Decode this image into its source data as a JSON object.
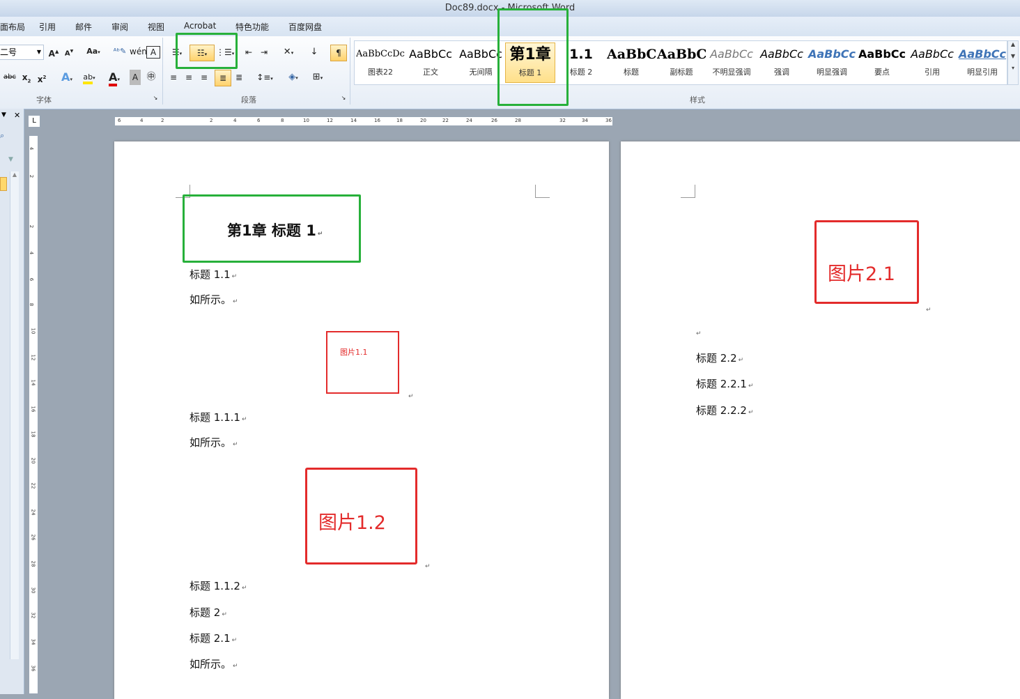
{
  "window": {
    "title": "Doc89.docx - Microsoft Word"
  },
  "tabs": [
    "页面布局",
    "引用",
    "邮件",
    "审阅",
    "视图",
    "Acrobat",
    "特色功能",
    "百度网盘"
  ],
  "font_group": {
    "font_size": "二号",
    "label": "字体"
  },
  "paragraph_group": {
    "label": "段落"
  },
  "styles_group": {
    "label": "样式",
    "items": [
      {
        "preview": "AaBbCcDc",
        "name": "图表22"
      },
      {
        "preview": "AaBbCc",
        "name": "正文"
      },
      {
        "preview": "AaBbCc",
        "name": "无间隔"
      },
      {
        "preview": "第1章",
        "name": "标题 1"
      },
      {
        "preview": "1.1",
        "name": "标题 2"
      },
      {
        "preview": "AaBbC",
        "name": "标题"
      },
      {
        "preview": "AaBbC",
        "name": "副标题"
      },
      {
        "preview": "AaBbCc",
        "name": "不明显强调"
      },
      {
        "preview": "AaBbCc",
        "name": "强调"
      },
      {
        "preview": "AaBbCc",
        "name": "明显强调"
      },
      {
        "preview": "AaBbCc",
        "name": "要点"
      },
      {
        "preview": "AaBbCc",
        "name": "引用"
      },
      {
        "preview": "AaBbCc",
        "name": "明显引用"
      }
    ]
  },
  "ruler": {
    "h_ticks": [
      "6",
      "4",
      "2",
      "2",
      "4",
      "6",
      "8",
      "10",
      "12",
      "14",
      "16",
      "18",
      "20",
      "22",
      "24",
      "26",
      "28",
      "32",
      "34",
      "36"
    ],
    "v_ticks": [
      "4",
      "2",
      "2",
      "4",
      "6",
      "8",
      "10",
      "12",
      "14",
      "16",
      "18",
      "20",
      "22",
      "24",
      "26",
      "28",
      "30",
      "32",
      "34",
      "36"
    ]
  },
  "page1": {
    "heading": "第1章  标题 1",
    "lines": [
      "标题 1.1",
      "如所示。",
      "标题 1.1.1",
      "如所示。",
      "标题 1.1.2",
      "标题 2",
      "标题 2.1",
      "如所示。"
    ],
    "image1": "图片1.1",
    "image2": "图片1.2"
  },
  "page2": {
    "image": "图片2.1",
    "lines": [
      "标题 2.2",
      "标题 2.2.1",
      "标题 2.2.2"
    ]
  }
}
